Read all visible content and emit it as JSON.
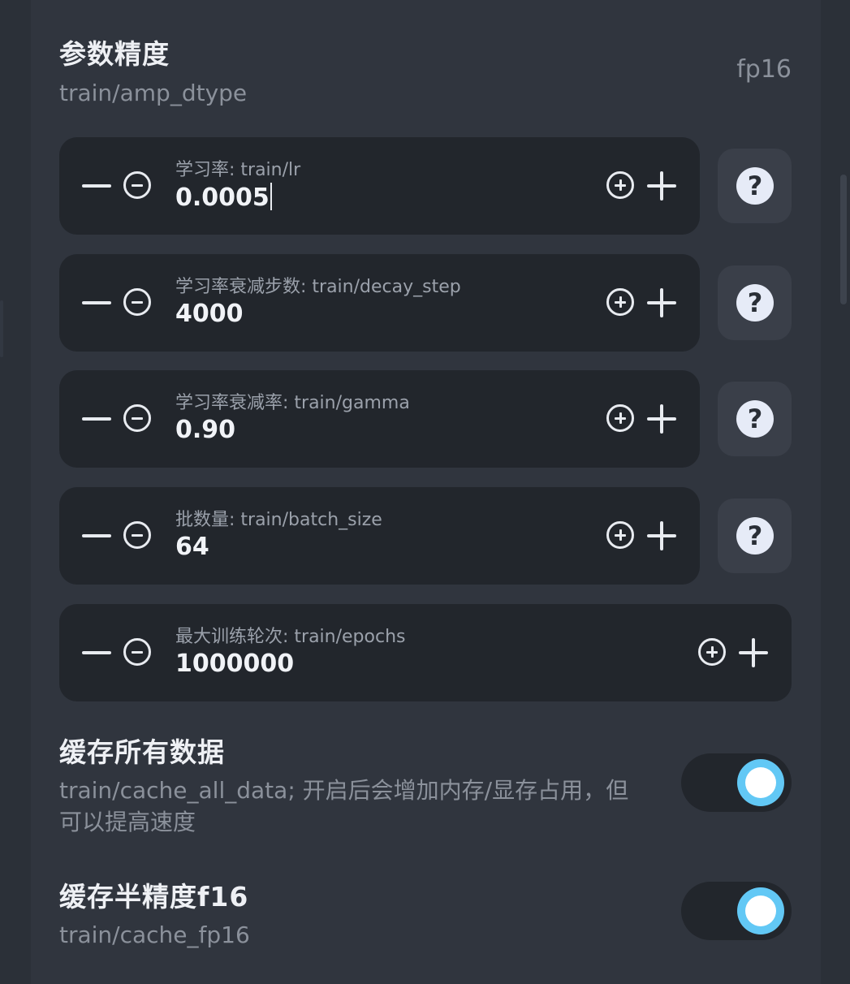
{
  "amp": {
    "title": "参数精度",
    "key": "train/amp_dtype",
    "value": "fp16"
  },
  "inputs": [
    {
      "label": "学习率: train/lr",
      "value": "0.0005"
    },
    {
      "label": "学习率衰减步数: train/decay_step",
      "value": "4000"
    },
    {
      "label": "学习率衰减率: train/gamma",
      "value": "0.90"
    },
    {
      "label": "批数量: train/batch_size",
      "value": "64"
    },
    {
      "label": "最大训练轮次: train/epochs",
      "value": "1000000"
    }
  ],
  "help_glyph": "?",
  "cache_all": {
    "title": "缓存所有数据",
    "desc_line1": "train/cache_all_data; 开启后会增加内存/显存占用，但",
    "desc_line2": "可以提高速度",
    "enabled": true
  },
  "cache_fp16": {
    "title": "缓存半精度f16",
    "key": "train/cache_fp16",
    "enabled": true
  },
  "colors": {
    "accent": "#62c8f5",
    "card": "#22262c",
    "panel": "#30353e"
  },
  "icons": [
    "minus-icon",
    "minus-circle-icon",
    "plus-circle-icon",
    "plus-icon",
    "help-icon"
  ]
}
